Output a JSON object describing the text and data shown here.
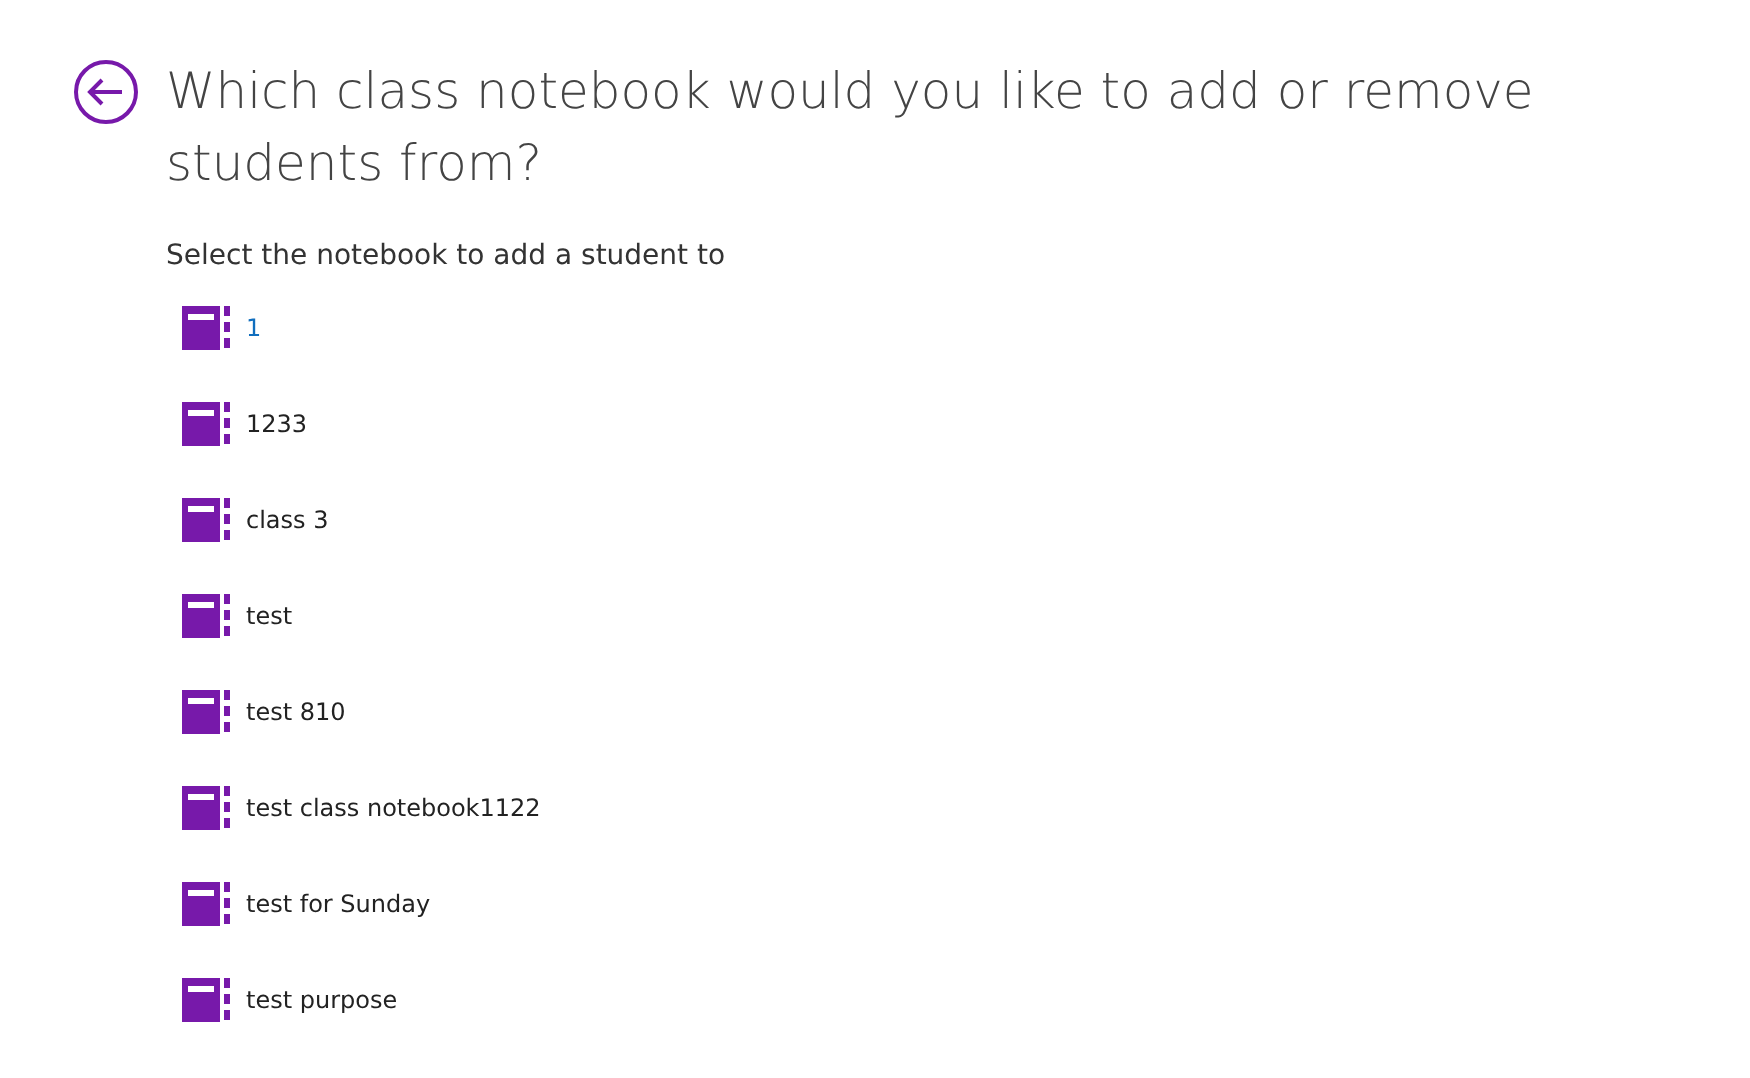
{
  "heading": "Which class notebook would you like to add or remove students from?",
  "instruction": "Select the notebook to add a student to",
  "notebooks": [
    {
      "name": "1",
      "selected": true
    },
    {
      "name": "1233",
      "selected": false
    },
    {
      "name": "class 3",
      "selected": false
    },
    {
      "name": "test",
      "selected": false
    },
    {
      "name": "test 810",
      "selected": false
    },
    {
      "name": "test class notebook1122",
      "selected": false
    },
    {
      "name": "test for Sunday",
      "selected": false
    },
    {
      "name": "test purpose",
      "selected": false
    }
  ]
}
